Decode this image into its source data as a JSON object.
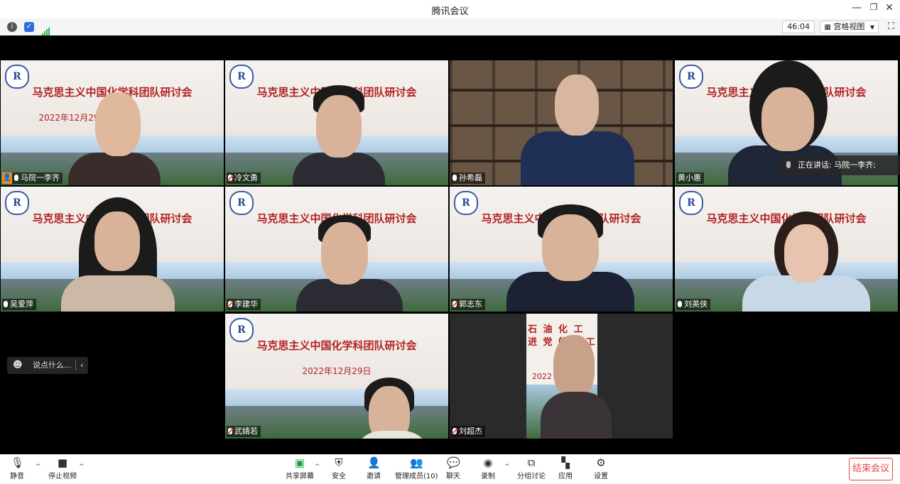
{
  "window": {
    "title": "腾讯会议"
  },
  "topbar": {
    "timer": "46:04",
    "view_label": "宫格视图"
  },
  "banner": {
    "title": "马克思主义中国化学科团队研讨会",
    "date": "2022年12月29日"
  },
  "tiles": [
    {
      "name": "马院一李齐",
      "mic": "on"
    },
    {
      "name": "冷文勇",
      "mic": "muted"
    },
    {
      "name": "孙希磊",
      "mic": "on"
    },
    {
      "name": "黄小惠",
      "mic": "none"
    },
    {
      "name": "吴爱萍",
      "mic": "on"
    },
    {
      "name": "李建华",
      "mic": "muted"
    },
    {
      "name": "郭志东",
      "mic": "muted"
    },
    {
      "name": "刘英侠",
      "mic": "on"
    },
    {
      "name": "武婧若",
      "mic": "muted"
    },
    {
      "name": "刘超杰",
      "mic": "muted"
    }
  ],
  "speaking": {
    "text": "正在讲话: 马院一李齐;"
  },
  "chat": {
    "placeholder": "说点什么..."
  },
  "toolbar": {
    "mute": "静音",
    "stop_video": "停止视频",
    "share": "共享屏幕",
    "security": "安全",
    "invite": "邀请",
    "members": "管理成员(10)",
    "chat": "聊天",
    "record": "录制",
    "breakout": "分组讨论",
    "apps": "应用",
    "settings": "设置",
    "end": "结束会议"
  },
  "tile10_text": "石 油 化 工 进 党 的 ” 工",
  "tile10_date": "2022"
}
